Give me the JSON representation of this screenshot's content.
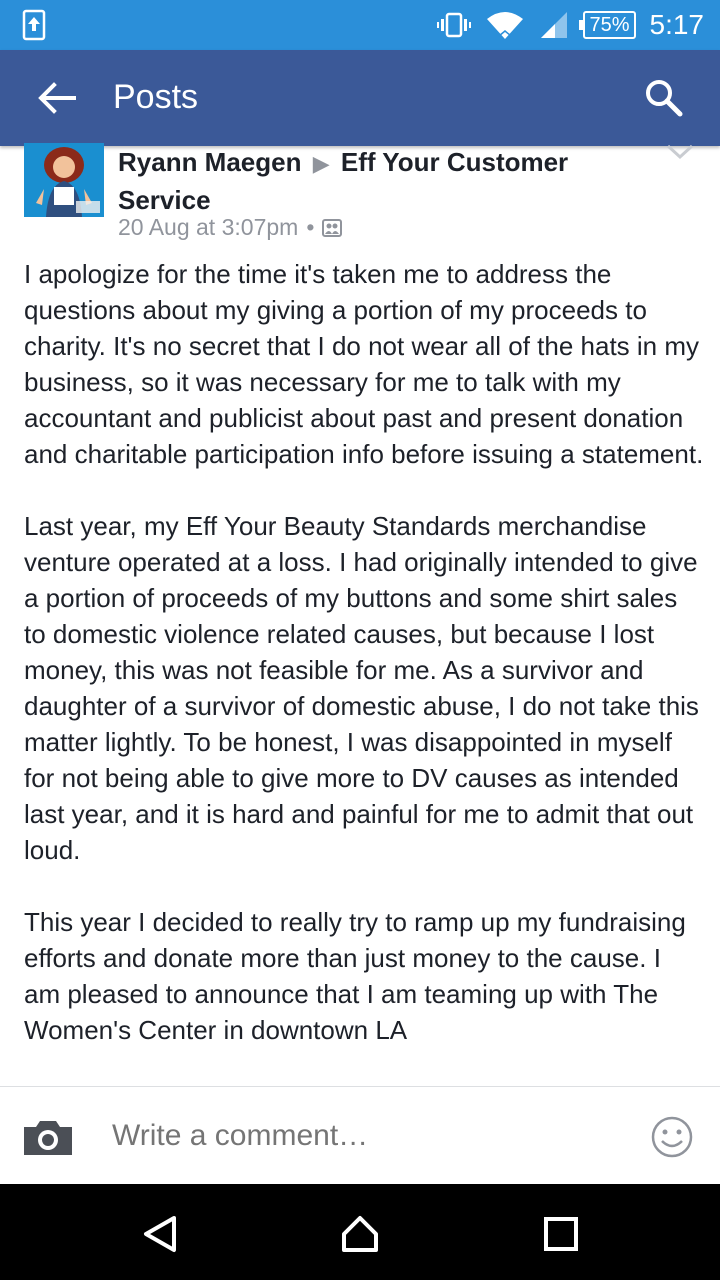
{
  "status_bar": {
    "battery": "75%",
    "time": "5:17"
  },
  "app_bar": {
    "title": "Posts"
  },
  "post": {
    "author": "Ryann Maegen",
    "target_group": "Eff Your Customer Service",
    "timestamp": "20 Aug at 3:07pm",
    "separator": "•",
    "paragraphs": [
      "I apologize for the time it's taken me to address the questions about my giving a portion of my proceeds to charity. It's no secret that I do not wear all of the hats in my business, so it was necessary for me to talk with my accountant and publicist about past and present donation and charitable participation info before issuing a statement.",
      "Last year, my Eff Your Beauty Standards merchandise venture operated at a loss. I had originally intended to give a portion of proceeds of my buttons and some shirt sales to domestic violence related causes, but because I lost money, this was not feasible for me. As a survivor and daughter of a survivor of domestic abuse, I do not take this matter lightly. To be honest, I was disappointed in myself for not being able to give more to DV causes as intended last year, and it is hard and painful for me to admit that out loud.",
      "This year I decided to really try to ramp up my fundraising efforts and donate more than just money to the cause. I am pleased to announce that I am teaming up with The Women's Center in downtown LA"
    ]
  },
  "comment_bar": {
    "placeholder": "Write a comment…"
  },
  "colors": {
    "status_bar": "#2b8fd9",
    "app_bar": "#3b5998",
    "text": "#1d2129",
    "meta": "#90949c"
  }
}
